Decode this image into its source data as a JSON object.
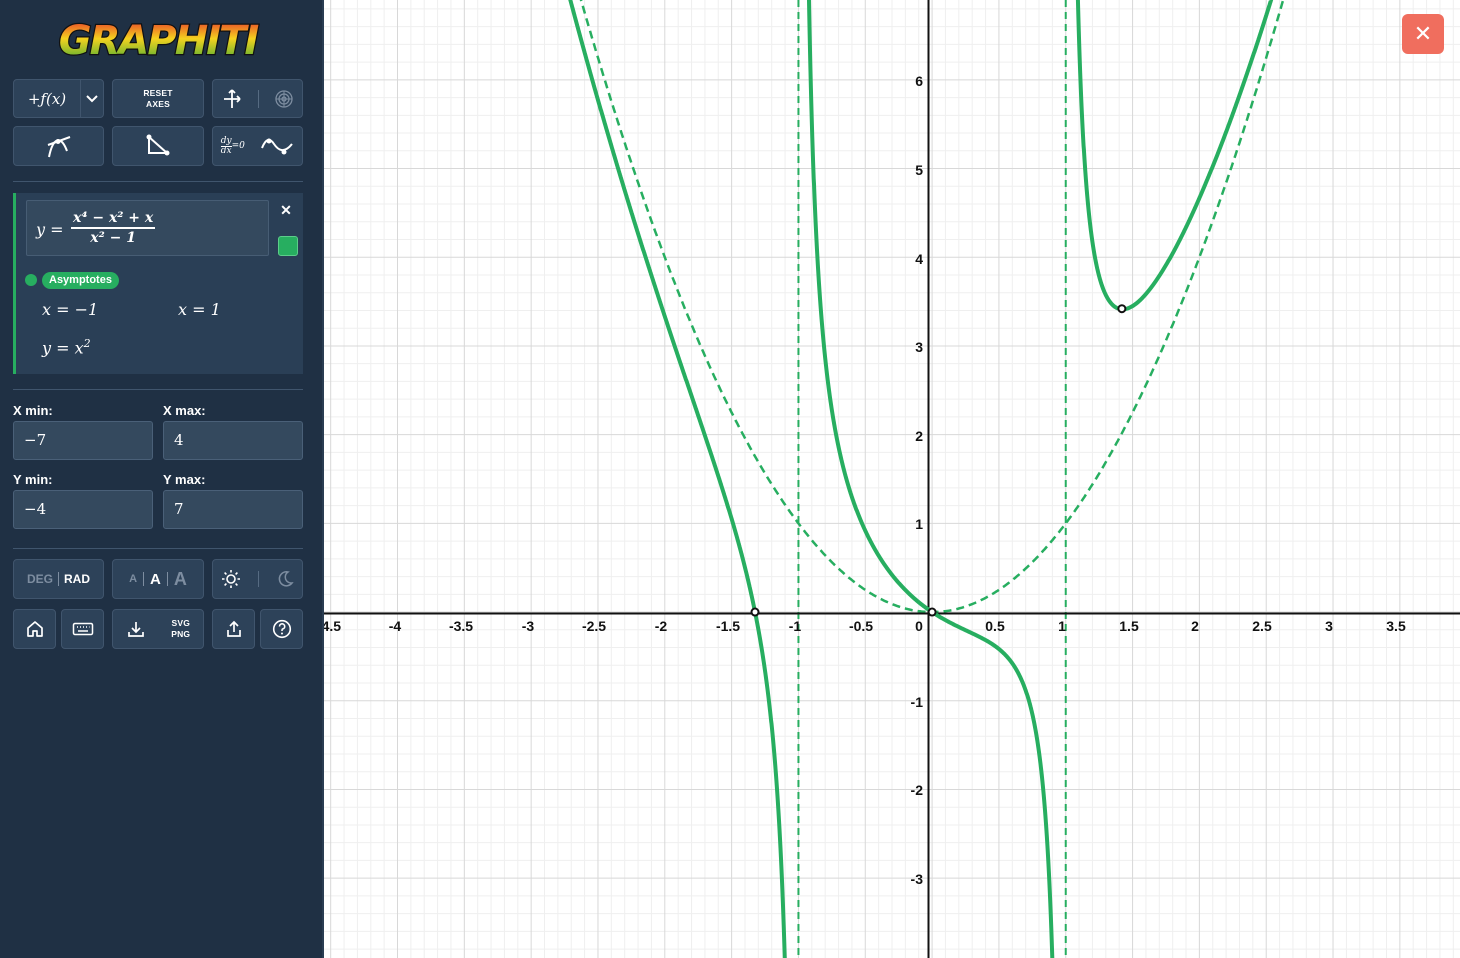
{
  "app": {
    "logo_text": "GRAPHITI"
  },
  "toolbar": {
    "add_function_label": "+ƒ(x)",
    "reset_axes_line1": "RESET",
    "reset_axes_line2": "AXES",
    "derivative_label": "dy/dx=0",
    "export_line1": "SVG",
    "export_line2": "PNG",
    "deg_label": "DEG",
    "rad_label": "RAD",
    "font_small": "A",
    "font_medium": "A",
    "font_large": "A"
  },
  "expression": {
    "lhs": "y =",
    "numerator": "x⁴ − x² + x",
    "denominator": "x² − 1",
    "color": "#27ae60",
    "close_symbol": "✕",
    "asymptotes_label": "Asymptotes",
    "asymptotes": [
      "x = −1",
      "x = 1",
      "y = x²"
    ]
  },
  "ranges": {
    "x_min_label": "X min:",
    "x_min": "−7",
    "x_max_label": "X max:",
    "x_max": "4",
    "y_min_label": "Y min:",
    "y_min": "−4",
    "y_max_label": "Y max:",
    "y_max": "7"
  },
  "graph": {
    "x_ticks": [
      "-4.5",
      "-4",
      "-3.5",
      "-3",
      "-2.5",
      "-2",
      "-1.5",
      "-1",
      "-0.5",
      "0",
      "0.5",
      "1",
      "1.5",
      "2",
      "2.5",
      "3",
      "3.5"
    ],
    "y_ticks_pos": [
      "1",
      "2",
      "3",
      "4",
      "5",
      "6"
    ],
    "y_ticks_neg": [
      "-1",
      "-2",
      "-3"
    ],
    "view": {
      "xmin": -4.55,
      "xmax": 3.95,
      "ymin": -3.9,
      "ymax": 6.9
    },
    "curve_color": "#27ae60",
    "asymptote_x": [
      -1,
      1
    ],
    "points": [
      {
        "x": -1.325,
        "y": 0
      },
      {
        "x": 0,
        "y": 0
      },
      {
        "x": 1.42,
        "y": 3.42
      }
    ]
  },
  "close_button": {
    "symbol": "✕",
    "color": "#f06e5e"
  }
}
